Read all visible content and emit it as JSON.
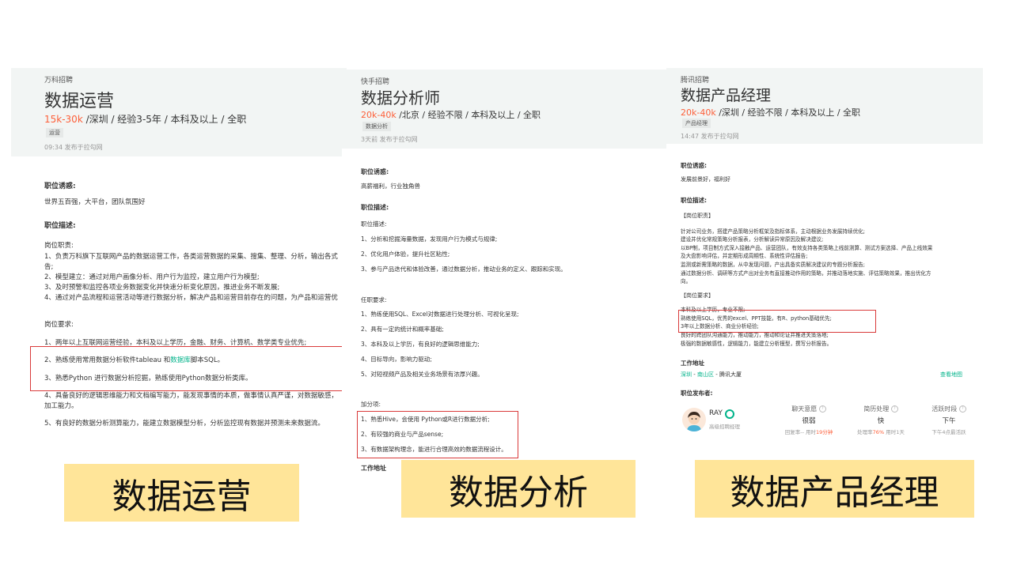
{
  "panel1": {
    "company": "万科招聘",
    "title": "数据运营",
    "salary": "15k-30k",
    "requirements": " /深圳 / 经验3-5年 / 本科及以上 / 全职",
    "tag": "运营",
    "post_time": "09:34  发布于拉勾网",
    "section_temptation": "职位诱惑:",
    "temptation": "世界五百强，大平台，团队氛围好",
    "section_description": "职位描述:",
    "duties_header": "岗位职责:",
    "duties": [
      "1、负责万科旗下互联网产品的数据运营工作，各类运营数据的采集、搜集、整理、分析，输出各式",
      "告;",
      "2、模型建立：通过对用户画像分析、用户行为监控，建立用户行为模型;",
      "3、及时预警和监控各项业务数据变化并快速分析变化原因，推进业务不断发展;",
      "4、通过对产品流程和运营活动等进行数据分析，解决产品和运营目前存在的问题，为产品和运营优"
    ],
    "reqs_header": "岗位要求:",
    "req1": "1、两年以上互联网运营经验，本科及以上学历，金融、财务、计算机、数学类专业优先;",
    "req2_a": "2、熟练使用常用数据分析软件tableau 和",
    "req2_b": "数据库",
    "req2_c": "脚本SQL。",
    "req3": "3、熟悉Python 进行数据分析挖掘，熟练使用Python数据分析类库。",
    "req4": "4、具备良好的逻辑思维能力和文档编写能力，能发现事情的本质，做事情认真严谨，对数据敏感，",
    "req4b": "加工能力。",
    "req5": "5、有良好的数据分析测算能力，能建立数据模型分析，分析监控现有数据并预测未来数据流。"
  },
  "panel2": {
    "company": "快手招聘",
    "title": "数据分析师",
    "salary": "20k-40k",
    "requirements": " /北京 / 经验不限 / 本科及以上 / 全职",
    "tag": "数据分析",
    "post_time": "3天前  发布于拉勾网",
    "section_temptation": "职位诱惑:",
    "temptation": "高薪福利，行业独角兽",
    "section_description": "职位描述:",
    "desc_header": "职位描述:",
    "desc": [
      "1、分析和挖掘海量数据，发现用户行为模式与规律;",
      "2、优化用户体验，提升社区粘性;",
      "3、参与产品迭代和体验改善，通过数据分析，推动业务的定义、跟踪和实现。"
    ],
    "reqs_header": "任职要求:",
    "reqs": [
      "1、熟练使用SQL、Excel对数据进行处理分析、可视化呈现;",
      "2、具有一定的统计和概率基础;",
      "3、本科及以上学历，有良好的逻辑思维能力;",
      "4、目标导向，影响力驱动;",
      "5、对短视频产品及相关业务场景有浓厚兴趣。"
    ],
    "bonus_header": "加分项:",
    "bonus": [
      "1、熟悉Hive，会使用 Python或R进行数据分析;",
      "2、有较强的商业与产品sense;",
      "3、有数据架构理念，能进行合理高效的数据流程设计。"
    ],
    "address_header": "工作地址"
  },
  "panel3": {
    "company": "腾讯招聘",
    "title": "数据产品经理",
    "salary": "20k-40k",
    "requirements": " /深圳 / 经验不限 / 本科及以上 / 全职",
    "tag": "产品经理",
    "post_time": "14:47  发布于拉勾网",
    "section_temptation": "职位诱惑:",
    "temptation": "发展前景好，福利好",
    "section_description": "职位描述:",
    "duties_header": "【岗位职责】",
    "duties": [
      "针对公司业务，搭建产品策略分析框架及指标体系，主动根据业务发展持续优化;",
      "    建设并优化常规策略分析报表，分析解读异常原因及解决建议;",
      "    以BP制，项目制方式深入接触产品、运营团队，有效支持各类策略上线前测算、测试方案选择、产品上线效果",
      "及大盘影响评估，并定期形成周期性、系统性评估报告;",
      "    监测或新需策略的数据，从中发现问题，产出具备实质解决建议的专题分析报告;",
      "    通过数据分析、调研等方式产出对业务有直接推动作用的策略，并推动落地实施、评估策略效果，推出优化方",
      "向。"
    ],
    "reqs_header": "【岗位要求】",
    "reqs": [
      "    本科及以上学历，专业不限;",
      "    熟练使用SQL，优秀的excel、PPT技能，有R、python基础优先;",
      "    3年以上数据分析、商业分析经验;",
      "    良好的跨团队沟通能力，推动能力，推动和论证并推进关策落地;",
      "    极强的数据敏感性，逻辑能力，能建立分析模型，撰写分析报告。"
    ],
    "address_header": "工作地址",
    "address_city": "深圳",
    "address_district": "南山区",
    "address_place": "腾讯大厦",
    "address_sep1": " - ",
    "address_sep2": " - ",
    "map_link": "查看地图",
    "publisher_header": "职位发布者:",
    "publisher_name": "RAY",
    "publisher_role": "高级招聘经理",
    "stats": [
      {
        "label": "聊天意愿",
        "value": "很弱",
        "sub_a": "回复率-- ",
        "sub_b": "用时",
        "sub_o": "19分钟",
        "sub_c": ""
      },
      {
        "label": "简历处理",
        "value": "快",
        "sub_a": "处理率",
        "sub_o": "76%",
        "sub_b": "  用时1天",
        "sub_c": ""
      },
      {
        "label": "活跃时段",
        "value": "下午",
        "sub_a": "下午4点最活跃",
        "sub_o": "",
        "sub_b": "",
        "sub_c": ""
      }
    ]
  },
  "captions": {
    "c1": "数据运营",
    "c2": "数据分析",
    "c3": "数据产品经理"
  },
  "colors": {
    "salary": "#fd5f39",
    "accent_green": "#00b38a",
    "highlight_box": "#d93a3a",
    "caption_bg": "#ffe599",
    "header_bg": "#f2f5f4"
  }
}
